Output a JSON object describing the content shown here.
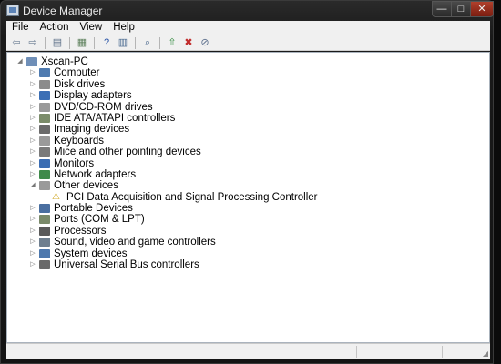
{
  "window": {
    "title": "Device Manager",
    "caption_min": "—",
    "caption_max": "□",
    "caption_close": "✕"
  },
  "menu": [
    "File",
    "Action",
    "View",
    "Help"
  ],
  "toolbar": [
    {
      "name": "back-icon",
      "glyph": "⇦",
      "color": "#6b7d93"
    },
    {
      "name": "forward-icon",
      "glyph": "⇨",
      "color": "#6b7d93"
    },
    {
      "name": "sep",
      "glyph": "",
      "color": ""
    },
    {
      "name": "show-hide-console-tree-icon",
      "glyph": "▤",
      "color": "#5b6f87"
    },
    {
      "name": "sep",
      "glyph": "",
      "color": ""
    },
    {
      "name": "properties-icon",
      "glyph": "▦",
      "color": "#5b7f5a"
    },
    {
      "name": "sep",
      "glyph": "",
      "color": ""
    },
    {
      "name": "help-icon",
      "glyph": "?",
      "color": "#2a55a8"
    },
    {
      "name": "action-pane-icon",
      "glyph": "▥",
      "color": "#4a6a90"
    },
    {
      "name": "sep",
      "glyph": "",
      "color": ""
    },
    {
      "name": "scan-hardware-icon",
      "glyph": "⌕",
      "color": "#3e5e86"
    },
    {
      "name": "sep",
      "glyph": "",
      "color": ""
    },
    {
      "name": "update-driver-icon",
      "glyph": "⇧",
      "color": "#2f8a3c"
    },
    {
      "name": "uninstall-icon",
      "glyph": "✖",
      "color": "#c02a2a"
    },
    {
      "name": "disable-device-icon",
      "glyph": "⊘",
      "color": "#5c6f8c"
    }
  ],
  "tree": [
    {
      "label": "Xscan-PC",
      "level": 0,
      "expander": "◢",
      "icon": "computer-root-icon",
      "color": "#6f8fb8"
    },
    {
      "label": "Computer",
      "level": 1,
      "expander": "▷",
      "icon": "computer-icon",
      "color": "#4f7bb0"
    },
    {
      "label": "Disk drives",
      "level": 1,
      "expander": "▷",
      "icon": "disk-drive-icon",
      "color": "#8c8c8c"
    },
    {
      "label": "Display adapters",
      "level": 1,
      "expander": "▷",
      "icon": "display-adapter-icon",
      "color": "#3c6fb5"
    },
    {
      "label": "DVD/CD-ROM drives",
      "level": 1,
      "expander": "▷",
      "icon": "dvd-drive-icon",
      "color": "#9a9a9a"
    },
    {
      "label": "IDE ATA/ATAPI controllers",
      "level": 1,
      "expander": "▷",
      "icon": "ide-controller-icon",
      "color": "#7b8c6a"
    },
    {
      "label": "Imaging devices",
      "level": 1,
      "expander": "▷",
      "icon": "camera-icon",
      "color": "#6b6b6b"
    },
    {
      "label": "Keyboards",
      "level": 1,
      "expander": "▷",
      "icon": "keyboard-icon",
      "color": "#9a9a9a"
    },
    {
      "label": "Mice and other pointing devices",
      "level": 1,
      "expander": "▷",
      "icon": "mouse-icon",
      "color": "#7a7a7a"
    },
    {
      "label": "Monitors",
      "level": 1,
      "expander": "▷",
      "icon": "monitor-icon",
      "color": "#3b6db3"
    },
    {
      "label": "Network adapters",
      "level": 1,
      "expander": "▷",
      "icon": "network-adapter-icon",
      "color": "#3f8a4a"
    },
    {
      "label": "Other devices",
      "level": 1,
      "expander": "◢",
      "icon": "other-devices-icon",
      "color": "#9a9a9a"
    },
    {
      "label": "PCI Data Acquisition and Signal Processing Controller",
      "level": 2,
      "expander": "",
      "icon": "warning-device-icon",
      "color": "#e7c32a"
    },
    {
      "label": "Portable Devices",
      "level": 1,
      "expander": "▷",
      "icon": "portable-device-icon",
      "color": "#4a6fa0"
    },
    {
      "label": "Ports (COM & LPT)",
      "level": 1,
      "expander": "▷",
      "icon": "port-icon",
      "color": "#7a8a6a"
    },
    {
      "label": "Processors",
      "level": 1,
      "expander": "▷",
      "icon": "processor-icon",
      "color": "#5a5a5a"
    },
    {
      "label": "Sound, video and game controllers",
      "level": 1,
      "expander": "▷",
      "icon": "sound-icon",
      "color": "#6f7f8f"
    },
    {
      "label": "System devices",
      "level": 1,
      "expander": "▷",
      "icon": "system-device-icon",
      "color": "#4d78ad"
    },
    {
      "label": "Universal Serial Bus controllers",
      "level": 1,
      "expander": "▷",
      "icon": "usb-icon",
      "color": "#6a6a6a"
    }
  ],
  "statusbar": {
    "text": ""
  }
}
